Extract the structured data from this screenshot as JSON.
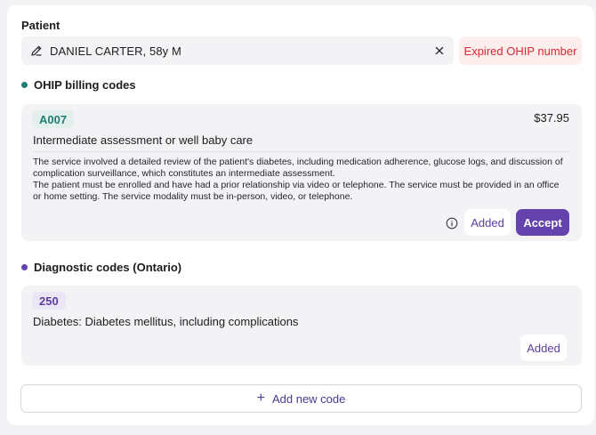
{
  "patient": {
    "section_label": "Patient",
    "name": "DANIEL CARTER, 58y M",
    "warning": "Expired OHIP number"
  },
  "billing": {
    "title": "OHIP billing codes",
    "dot_color": "#1e7f74",
    "code": "A007",
    "price": "$37.95",
    "code_title": "Intermediate assessment or well baby care",
    "description_1": "The service involved a detailed review of the patient's diabetes, including medication adherence, glucose logs, and discussion of complication surveillance, which constitutes an intermediate assessment.",
    "description_2": "The patient must be enrolled and have had a prior relationship via video or telephone. The service must be provided in an office or home setting. The service modality must be in-person, video, or telephone.",
    "added_label": "Added",
    "accept_label": "Accept"
  },
  "diagnostic": {
    "title": "Diagnostic codes (Ontario)",
    "dot_color": "#6443ad",
    "code": "250",
    "code_title": "Diabetes: Diabetes mellitus, including complications",
    "added_label": "Added"
  },
  "actions": {
    "add_new_code_label": "Add new code"
  },
  "colors": {
    "accent": "#6443ad",
    "teal_chip_bg": "#e3efec",
    "teal_chip_text": "#1e7f74",
    "purple_chip_bg": "#ebe6f5",
    "warning_text": "#d9262f"
  }
}
